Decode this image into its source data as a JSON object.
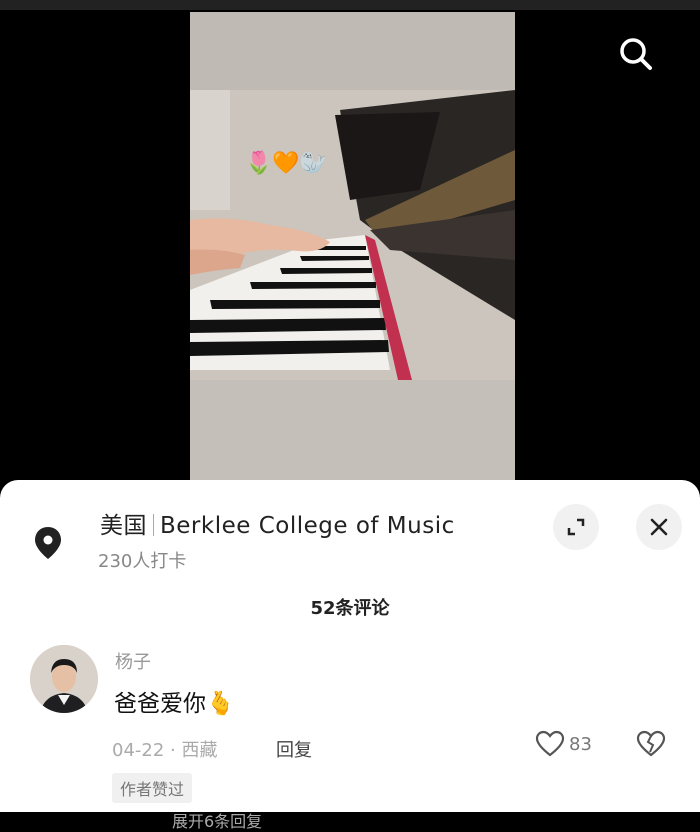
{
  "location": {
    "country": "美国",
    "place": "Berklee College of Music",
    "checkins": "230人打卡"
  },
  "comments_header": "52条评论",
  "comment": {
    "username": "杨子",
    "text": "爸爸爱你",
    "emoji": "🫰",
    "date": "04-22",
    "separator": "·",
    "region": "西藏",
    "reply_label": "回复",
    "like_count": "83",
    "author_badge": "作者赞过"
  },
  "more_replies": "展开6条回复",
  "video_overlay_emojis": "🌷🧡🦭",
  "colors": {
    "sheet_bg": "#ffffff",
    "text_primary": "#222222",
    "text_muted": "#999999"
  }
}
